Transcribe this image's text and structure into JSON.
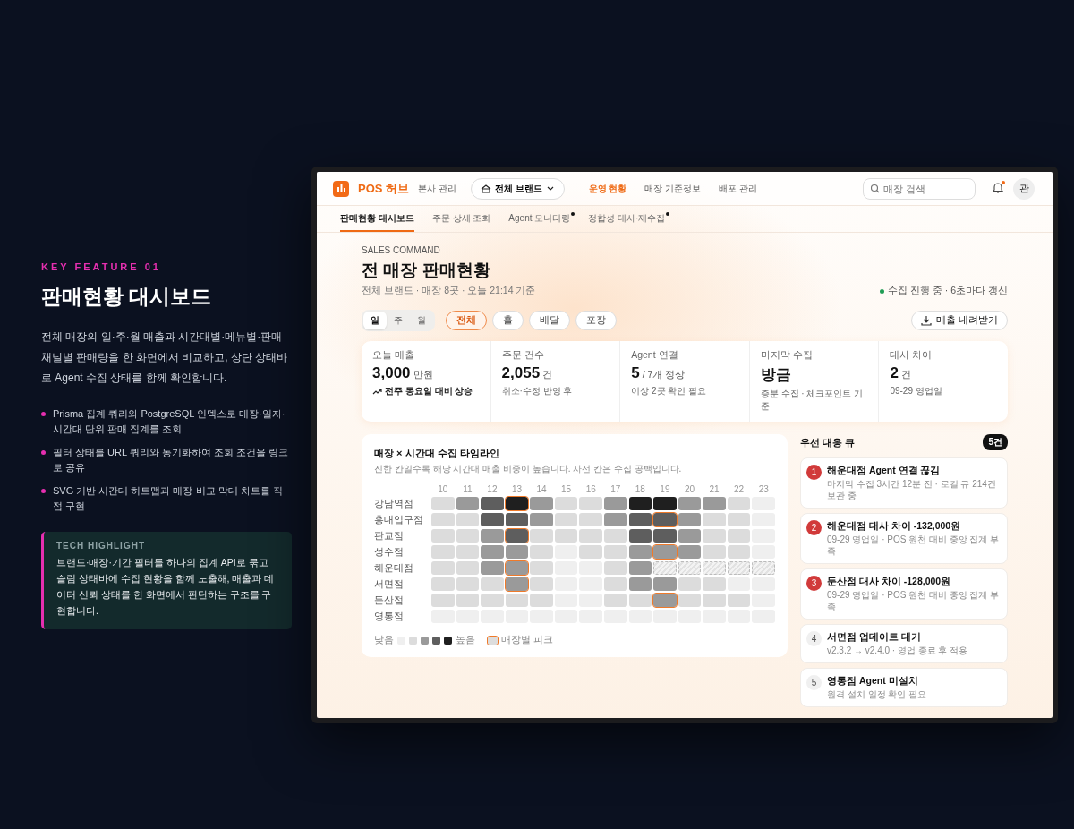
{
  "feature": {
    "eyebrow": "KEY FEATURE 01",
    "title": "판매현황 대시보드",
    "description": "전체 매장의 일·주·월 매출과 시간대별·메뉴별·판매채널별 판매량을 한 화면에서 비교하고, 상단 상태바로 Agent 수집 상태를 함께 확인합니다.",
    "bullets": [
      "Prisma 집계 쿼리와 PostgreSQL 인덱스로 매장·일자·시간대 단위 판매 집계를 조회",
      "필터 상태를 URL 쿼리와 동기화하여 조회 조건을 링크로 공유",
      "SVG 기반 시간대 히트맵과 매장 비교 막대 차트를 직접 구현"
    ],
    "highlight": {
      "title": "TECH HIGHLIGHT",
      "text": "브랜드·매장·기간 필터를 하나의 집계 API로 묶고 슬림 상태바에 수집 현황을 함께 노출해, 매출과 데이터 신뢰 상태를 한 화면에서 판단하는 구조를 구현합니다."
    }
  },
  "app": {
    "logo": "POS 허브",
    "logo_sub": "본사 관리",
    "brand_select": "전체 브랜드",
    "nav": [
      {
        "label": "운영 현황",
        "selected": true
      },
      {
        "label": "매장 기준정보",
        "selected": false
      },
      {
        "label": "배포 관리",
        "selected": false
      }
    ],
    "search": {
      "placeholder": "매장 검색"
    },
    "bell_unread": true,
    "avatar": "관",
    "tabs": [
      {
        "label": "판매현황 대시보드",
        "selected": true,
        "alert": false
      },
      {
        "label": "주문 상세 조회",
        "selected": false,
        "alert": false
      },
      {
        "label": "Agent 모니터링",
        "selected": false,
        "alert": true
      },
      {
        "label": "정합성 대사·재수집",
        "selected": false,
        "alert": true
      }
    ],
    "eyebrow": "SALES COMMAND",
    "title": "전 매장 판매현황",
    "subtitle": "전체 브랜드 · 매장 8곳 · 오늘 21:14 기준",
    "status": {
      "text": "수집 진행 중 · 6초마다 갱신",
      "color": "#1f9d55"
    },
    "periods": [
      {
        "label": "일",
        "selected": true
      },
      {
        "label": "주",
        "selected": false
      },
      {
        "label": "월",
        "selected": false
      }
    ],
    "channels": [
      {
        "label": "전체",
        "selected": true
      },
      {
        "label": "홀",
        "selected": false
      },
      {
        "label": "배달",
        "selected": false
      },
      {
        "label": "포장",
        "selected": false
      }
    ],
    "download": "매출 내려받기",
    "kpis": [
      {
        "label": "오늘 매출",
        "value": "3,000",
        "unit": "만원",
        "note": "전주 동요일 대비 상승",
        "trend_up": true
      },
      {
        "label": "주문 건수",
        "value": "2,055",
        "unit": "건",
        "note": "취소·수정 반영 후",
        "trend_up": false
      },
      {
        "label": "Agent 연결",
        "value": "5",
        "unit": "/ 7개 정상",
        "note": "이상 2곳 확인 필요",
        "trend_up": false
      },
      {
        "label": "마지막 수집",
        "value": "방금",
        "note": "증분 수집 · 체크포인트 기준",
        "trend_up": false
      },
      {
        "label": "대사 차이",
        "value": "2",
        "unit": "건",
        "note": "09-29 영업일",
        "trend_up": false
      }
    ],
    "heatmap": {
      "title": "매장 × 시간대 수집 타임라인",
      "subtitle": "진한 칸일수록 해당 시간대 매출 비중이 높습니다. 사선 칸은 수집 공백입니다.",
      "hours": [
        "10",
        "11",
        "12",
        "13",
        "14",
        "15",
        "16",
        "17",
        "18",
        "19",
        "20",
        "21",
        "22",
        "23"
      ],
      "rows": [
        {
          "store": "강남역점",
          "cells": [
            {
              "color": "#dcdcdc"
            },
            {
              "color": "#9a9a9a"
            },
            {
              "color": "#5e5e5e"
            },
            {
              "color": "#1f1f1f",
              "peak": true
            },
            {
              "color": "#9a9a9a"
            },
            {
              "color": "#dcdcdc"
            },
            {
              "color": "#dcdcdc"
            },
            {
              "color": "#9a9a9a"
            },
            {
              "color": "#1f1f1f"
            },
            {
              "color": "#1f1f1f"
            },
            {
              "color": "#9a9a9a"
            },
            {
              "color": "#9a9a9a"
            },
            {
              "color": "#dcdcdc"
            },
            {
              "color": "#efefef"
            }
          ]
        },
        {
          "store": "홍대입구점",
          "cells": [
            {
              "color": "#dcdcdc"
            },
            {
              "color": "#dcdcdc"
            },
            {
              "color": "#5e5e5e"
            },
            {
              "color": "#5e5e5e"
            },
            {
              "color": "#9a9a9a"
            },
            {
              "color": "#dcdcdc"
            },
            {
              "color": "#dcdcdc"
            },
            {
              "color": "#9a9a9a"
            },
            {
              "color": "#5e5e5e"
            },
            {
              "color": "#5e5e5e",
              "peak": true
            },
            {
              "color": "#9a9a9a"
            },
            {
              "color": "#dcdcdc"
            },
            {
              "color": "#dcdcdc"
            },
            {
              "color": "#efefef"
            }
          ]
        },
        {
          "store": "판교점",
          "cells": [
            {
              "color": "#dcdcdc"
            },
            {
              "color": "#dcdcdc"
            },
            {
              "color": "#9a9a9a"
            },
            {
              "color": "#5e5e5e",
              "peak": true
            },
            {
              "color": "#dcdcdc"
            },
            {
              "color": "#dcdcdc"
            },
            {
              "color": "#dcdcdc"
            },
            {
              "color": "#dcdcdc"
            },
            {
              "color": "#5e5e5e"
            },
            {
              "color": "#5e5e5e"
            },
            {
              "color": "#9a9a9a"
            },
            {
              "color": "#dcdcdc"
            },
            {
              "color": "#dcdcdc"
            },
            {
              "color": "#efefef"
            }
          ]
        },
        {
          "store": "성수점",
          "cells": [
            {
              "color": "#dcdcdc"
            },
            {
              "color": "#dcdcdc"
            },
            {
              "color": "#9a9a9a"
            },
            {
              "color": "#9a9a9a"
            },
            {
              "color": "#dcdcdc"
            },
            {
              "color": "#efefef"
            },
            {
              "color": "#dcdcdc"
            },
            {
              "color": "#dcdcdc"
            },
            {
              "color": "#9a9a9a"
            },
            {
              "color": "#9a9a9a",
              "peak": true
            },
            {
              "color": "#9a9a9a"
            },
            {
              "color": "#dcdcdc"
            },
            {
              "color": "#dcdcdc"
            },
            {
              "color": "#efefef"
            }
          ]
        },
        {
          "store": "해운대점",
          "cells": [
            {
              "color": "#dcdcdc"
            },
            {
              "color": "#dcdcdc"
            },
            {
              "color": "#9a9a9a"
            },
            {
              "color": "#9a9a9a",
              "peak": true
            },
            {
              "color": "#dcdcdc"
            },
            {
              "color": "#efefef"
            },
            {
              "color": "#efefef"
            },
            {
              "color": "#dcdcdc"
            },
            {
              "color": "#9a9a9a"
            },
            {
              "missing": true
            },
            {
              "missing": true
            },
            {
              "missing": true
            },
            {
              "missing": true
            },
            {
              "missing": true
            }
          ]
        },
        {
          "store": "서면점",
          "cells": [
            {
              "color": "#dcdcdc"
            },
            {
              "color": "#dcdcdc"
            },
            {
              "color": "#dcdcdc"
            },
            {
              "color": "#9a9a9a",
              "peak": true
            },
            {
              "color": "#dcdcdc"
            },
            {
              "color": "#efefef"
            },
            {
              "color": "#efefef"
            },
            {
              "color": "#dcdcdc"
            },
            {
              "color": "#9a9a9a"
            },
            {
              "color": "#9a9a9a"
            },
            {
              "color": "#dcdcdc"
            },
            {
              "color": "#dcdcdc"
            },
            {
              "color": "#efefef"
            },
            {
              "color": "#efefef"
            }
          ]
        },
        {
          "store": "둔산점",
          "cells": [
            {
              "color": "#dcdcdc"
            },
            {
              "color": "#dcdcdc"
            },
            {
              "color": "#dcdcdc"
            },
            {
              "color": "#dcdcdc"
            },
            {
              "color": "#dcdcdc"
            },
            {
              "color": "#efefef"
            },
            {
              "color": "#efefef"
            },
            {
              "color": "#dcdcdc"
            },
            {
              "color": "#dcdcdc"
            },
            {
              "color": "#9a9a9a",
              "peak": true
            },
            {
              "color": "#dcdcdc"
            },
            {
              "color": "#dcdcdc"
            },
            {
              "color": "#dcdcdc"
            },
            {
              "color": "#efefef"
            }
          ]
        },
        {
          "store": "영통점",
          "cells": [
            {
              "color": "#efefef"
            },
            {
              "color": "#efefef"
            },
            {
              "color": "#efefef"
            },
            {
              "color": "#efefef"
            },
            {
              "color": "#efefef"
            },
            {
              "color": "#efefef"
            },
            {
              "color": "#efefef"
            },
            {
              "color": "#efefef"
            },
            {
              "color": "#efefef"
            },
            {
              "color": "#efefef"
            },
            {
              "color": "#efefef"
            },
            {
              "color": "#efefef"
            },
            {
              "color": "#efefef"
            },
            {
              "color": "#efefef"
            }
          ]
        }
      ],
      "legend": {
        "low": "낮음",
        "high": "높음",
        "peak": "매장별 피크"
      }
    },
    "queue": {
      "title": "우선 대응 큐",
      "count": "5건",
      "items": [
        {
          "number": "1",
          "kind": "critical",
          "title": "해운대점 Agent 연결 끊김",
          "detail": "마지막 수집 3시간 12분 전 · 로컬 큐 214건 보관 중"
        },
        {
          "number": "2",
          "kind": "critical",
          "title": "해운대점 대사 차이 -132,000원",
          "detail": "09-29 영업일 · POS 원천 대비 중앙 집계 부족"
        },
        {
          "number": "3",
          "kind": "critical",
          "title": "둔산점 대사 차이 -128,000원",
          "detail": "09-29 영업일 · POS 원천 대비 중앙 집계 부족"
        },
        {
          "number": "4",
          "kind": "normal",
          "title": "서면점 업데이트 대기",
          "detail": "v2.3.2 → v2.4.0 · 영업 종료 후 적용"
        },
        {
          "number": "5",
          "kind": "normal",
          "title": "영통점 Agent 미설치",
          "detail": "원격 설치 일정 확인 필요"
        }
      ]
    }
  }
}
